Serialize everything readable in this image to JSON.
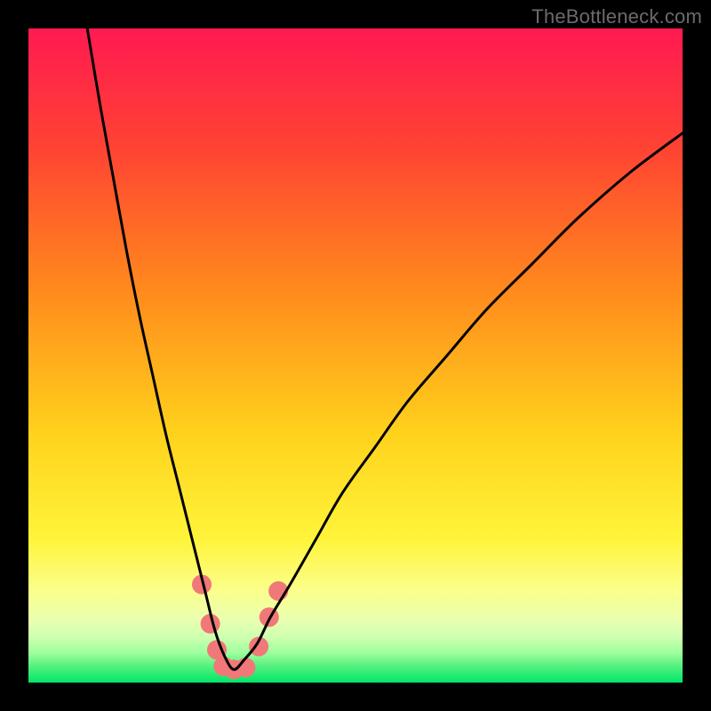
{
  "watermark": "TheBottleneck.com",
  "chart_data": {
    "type": "line",
    "title": "",
    "xlabel": "",
    "ylabel": "",
    "xlim": [
      0,
      100
    ],
    "ylim": [
      0,
      100
    ],
    "grid": false,
    "legend": false,
    "background_gradient_stops": [
      {
        "offset": 0.0,
        "color": "#ff1a52"
      },
      {
        "offset": 0.18,
        "color": "#ff4233"
      },
      {
        "offset": 0.4,
        "color": "#ff8a1c"
      },
      {
        "offset": 0.62,
        "color": "#ffd21c"
      },
      {
        "offset": 0.78,
        "color": "#fff43a"
      },
      {
        "offset": 0.86,
        "color": "#fbff8c"
      },
      {
        "offset": 0.905,
        "color": "#e9ffb0"
      },
      {
        "offset": 0.93,
        "color": "#cfffb0"
      },
      {
        "offset": 0.955,
        "color": "#9cff9c"
      },
      {
        "offset": 0.975,
        "color": "#55f07e"
      },
      {
        "offset": 1.0,
        "color": "#00e76a"
      }
    ],
    "series": [
      {
        "name": "bottleneck-curve",
        "color": "#000000",
        "stroke_width": 3,
        "x": [
          9,
          11,
          13,
          15,
          17,
          19,
          21,
          23,
          25,
          27,
          28.5,
          30,
          31.4,
          33,
          35,
          37,
          40,
          44,
          48,
          53,
          58,
          64,
          70,
          77,
          84,
          92,
          100
        ],
        "values": [
          100,
          88,
          77,
          66,
          56,
          47,
          38,
          30,
          22,
          14,
          8,
          4,
          2,
          3.5,
          6,
          10,
          15,
          22,
          29,
          36,
          43,
          50,
          57,
          64,
          71,
          78,
          84
        ]
      }
    ],
    "markers": {
      "name": "highlight-dots",
      "color": "#f07878",
      "radius": 11,
      "points": [
        {
          "x": 26.5,
          "y": 15
        },
        {
          "x": 27.8,
          "y": 9
        },
        {
          "x": 28.8,
          "y": 5
        },
        {
          "x": 29.8,
          "y": 2.5
        },
        {
          "x": 31.4,
          "y": 2
        },
        {
          "x": 33.2,
          "y": 2.3
        },
        {
          "x": 35.2,
          "y": 5.5
        },
        {
          "x": 36.8,
          "y": 10
        },
        {
          "x": 38.2,
          "y": 14
        }
      ]
    }
  }
}
